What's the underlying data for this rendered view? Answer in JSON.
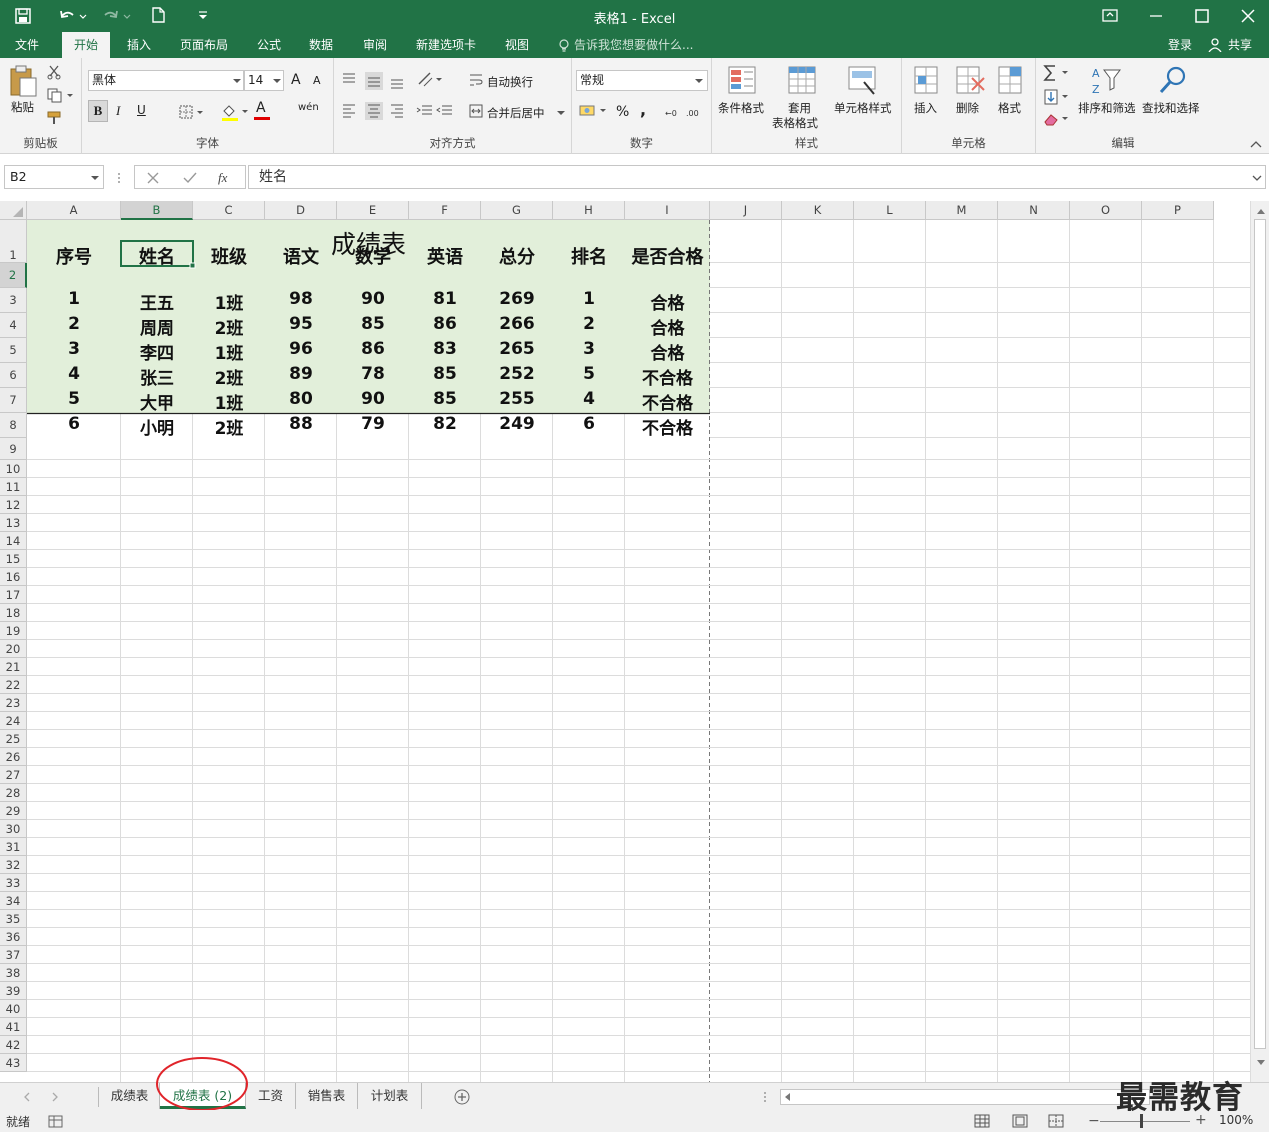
{
  "window": {
    "title": "表格1 - Excel"
  },
  "ribbon_tabs": [
    "文件",
    "开始",
    "插入",
    "页面布局",
    "公式",
    "数据",
    "审阅",
    "新建选项卡",
    "视图"
  ],
  "active_tab": "开始",
  "tell_me": "告诉我您想要做什么...",
  "account": {
    "login": "登录",
    "share": "共享"
  },
  "groups": {
    "clipboard": {
      "label": "剪贴板",
      "paste": "粘贴"
    },
    "font": {
      "label": "字体",
      "name": "黑体",
      "size": "14",
      "bold": "B",
      "italic": "I",
      "underline": "U",
      "grow": "A",
      "shrink": "A",
      "color_letter": "A",
      "wen": "wén"
    },
    "align": {
      "label": "对齐方式",
      "wrap": "自动换行",
      "merge": "合并后居中"
    },
    "number": {
      "label": "数字",
      "format": "常规",
      "percent": "%",
      "comma": ","
    },
    "styles": {
      "label": "样式",
      "conditional": "条件格式",
      "table_fmt_1": "套用",
      "table_fmt_2": "表格格式",
      "cell_styles": "单元格样式"
    },
    "cells": {
      "label": "单元格",
      "insert": "插入",
      "delete": "删除",
      "format": "格式"
    },
    "editing": {
      "label": "编辑",
      "sort_filter": "排序和筛选",
      "find_select": "查找和选择"
    }
  },
  "formula_bar": {
    "name_box": "B2",
    "fx": "fx",
    "value": "姓名"
  },
  "columns": [
    "A",
    "B",
    "C",
    "D",
    "E",
    "F",
    "G",
    "H",
    "I",
    "J",
    "K",
    "L",
    "M",
    "N",
    "O",
    "P"
  ],
  "rows": [
    "1",
    "2",
    "3",
    "4",
    "5",
    "6",
    "7",
    "8",
    "9",
    "10",
    "11",
    "12",
    "13",
    "14",
    "15",
    "16",
    "17",
    "18",
    "19",
    "20",
    "21",
    "22",
    "23",
    "24",
    "25",
    "26",
    "27",
    "28",
    "29",
    "30",
    "31",
    "32",
    "33",
    "34",
    "35",
    "36",
    "37",
    "38",
    "39",
    "40",
    "41",
    "42",
    "43"
  ],
  "table": {
    "title": "成绩表",
    "headers": [
      "序号",
      "姓名",
      "班级",
      "语文",
      "数学",
      "英语",
      "总分",
      "排名",
      "是否合格"
    ],
    "rows": [
      [
        "1",
        "王五",
        "1班",
        "98",
        "90",
        "81",
        "269",
        "1",
        "合格"
      ],
      [
        "2",
        "周周",
        "2班",
        "95",
        "85",
        "86",
        "266",
        "2",
        "合格"
      ],
      [
        "3",
        "李四",
        "1班",
        "96",
        "86",
        "83",
        "265",
        "3",
        "合格"
      ],
      [
        "4",
        "张三",
        "2班",
        "89",
        "78",
        "85",
        "252",
        "5",
        "不合格"
      ],
      [
        "5",
        "大甲",
        "1班",
        "80",
        "90",
        "85",
        "255",
        "4",
        "不合格"
      ],
      [
        "6",
        "小明",
        "2班",
        "88",
        "79",
        "82",
        "249",
        "6",
        "不合格"
      ]
    ]
  },
  "sheet_tabs": [
    "成绩表",
    "成绩表 (2)",
    "工资",
    "销售表",
    "计划表"
  ],
  "active_sheet": "成绩表 (2)",
  "status": {
    "ready": "就绪",
    "zoom": "100%"
  },
  "watermark": "最需教育",
  "colors": {
    "excel_green": "#217346",
    "table_fill": "#e2efda",
    "annotation_red": "#e0242a"
  }
}
